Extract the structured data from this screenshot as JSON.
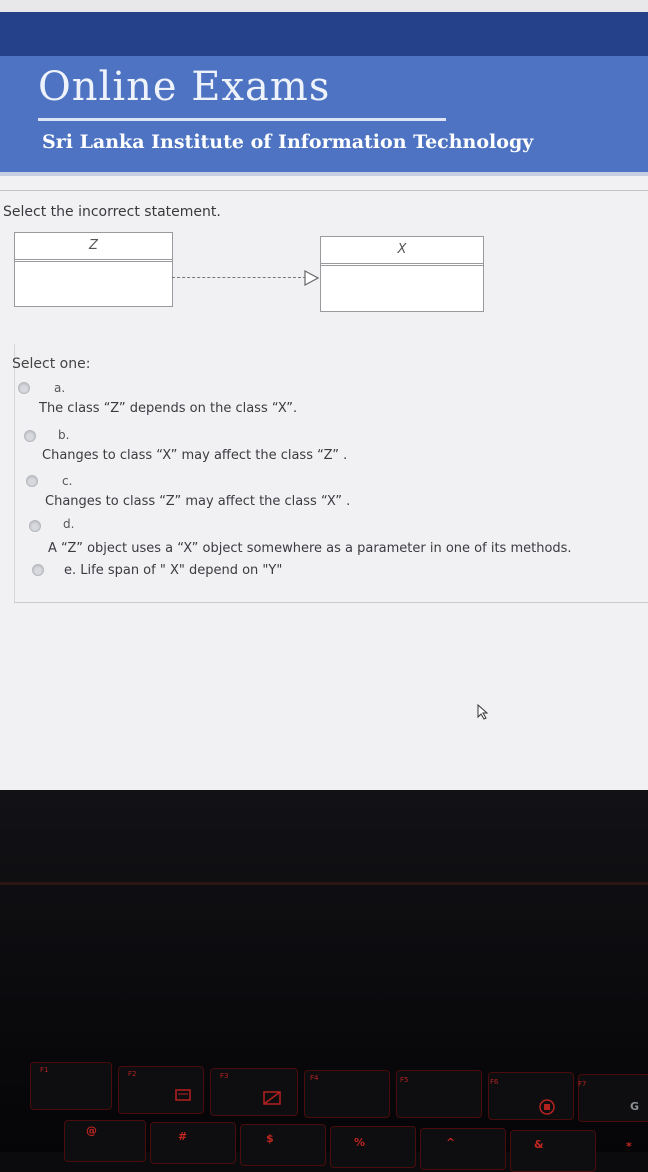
{
  "header": {
    "title": "Online Exams",
    "subtitle": "Sri Lanka Institute of Information Technology"
  },
  "question": {
    "text": "Select the incorrect statement.",
    "diagram": {
      "class_left": "Z",
      "class_right": "X"
    }
  },
  "answers": {
    "prompt": "Select one:",
    "options": [
      {
        "letter": "a.",
        "text": "The class “Z” depends on the class “X”."
      },
      {
        "letter": "b.",
        "text": "Changes to class “X” may affect the class “Z” ."
      },
      {
        "letter": "c.",
        "text": "Changes to class “Z” may affect the class “X” ."
      },
      {
        "letter": "d.",
        "text": "A “Z” object  uses a  “X” object somewhere as a parameter in one of its methods."
      },
      {
        "letter": "",
        "text": "e. Life span of \" X\" depend on \"Y\""
      }
    ]
  },
  "keyboard": {
    "function_keys": [
      "F1",
      "F2",
      "F3",
      "F4",
      "F5",
      "F6",
      "F7"
    ],
    "symbols": [
      "@",
      "#",
      "$",
      "%",
      "^",
      "&",
      "*"
    ],
    "letters": [
      "G"
    ]
  },
  "colors": {
    "banner": "#4d73c2",
    "navstrip": "#25418a",
    "keyboard_backlight": "#c3261f"
  }
}
